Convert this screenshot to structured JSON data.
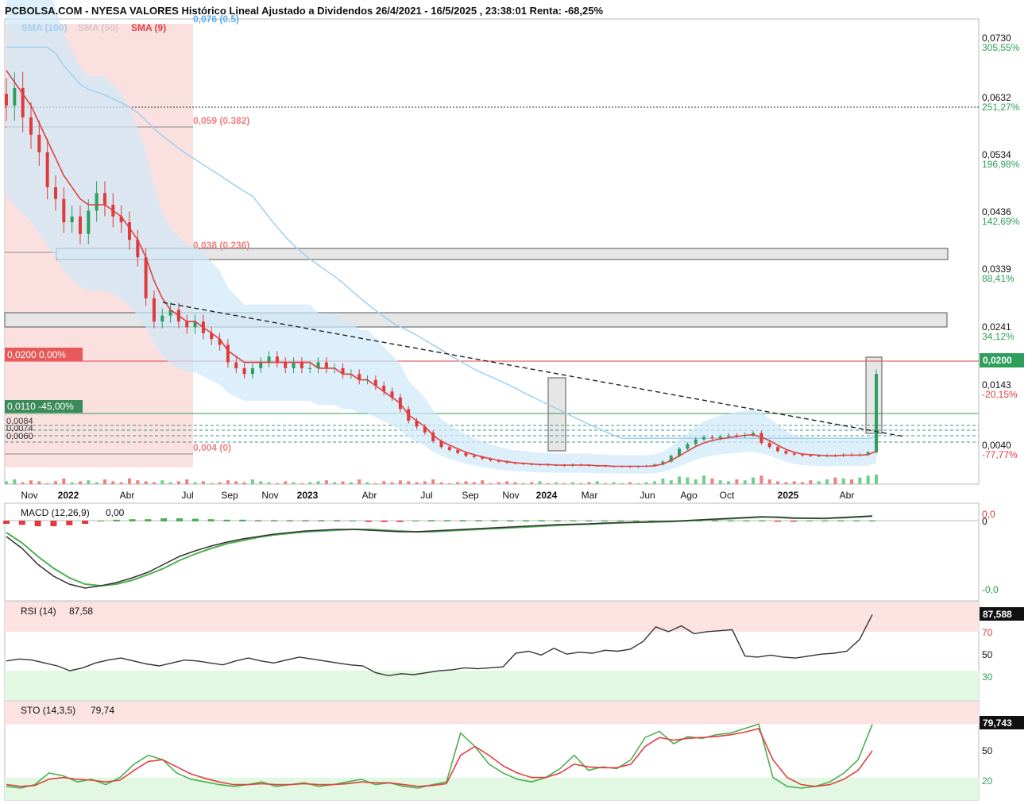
{
  "header": {
    "title": "PCBOLSA.COM - NYESA VALORES Histórico Lineal Ajustado a Dividendos 26/4/2021 - 16/5/2025 , 23:38:01 Renta: -68,25%"
  },
  "colors": {
    "up": "#2e9e5b",
    "down": "#e03a3a",
    "sma9": "#e04040",
    "sma100": "#9fd0f0",
    "bollinger": "#cfe8f8",
    "fib_zone": "#f9d5d5",
    "price_line": "#e04040",
    "macd_line": "#333333",
    "signal_line": "#4caf50",
    "rsi_line": "#333333",
    "sto_k": "#4caf50",
    "sto_d": "#e04040"
  },
  "chart_data": [
    {
      "type": "candlestick",
      "panel": "price",
      "indicators": {
        "legend_sma100": "SMA (100)",
        "legend_sma50": "SMA (50)",
        "legend_sma9": "SMA (9)"
      },
      "x_ticks": [
        "Nov",
        "2022",
        "Abr",
        "Jul",
        "Sep",
        "Nov",
        "2023",
        "Abr",
        "Jul",
        "Sep",
        "Nov",
        "2024",
        "Mar",
        "Jun",
        "Ago",
        "Oct",
        "2025",
        "Abr"
      ],
      "y_ticks": [
        {
          "value": "0,0730",
          "pct": "305,55%"
        },
        {
          "value": "0,0632",
          "pct": "251,27%"
        },
        {
          "value": "0,0534",
          "pct": "196,98%"
        },
        {
          "value": "0,0436",
          "pct": "142,69%"
        },
        {
          "value": "0,0339",
          "pct": "88,41%"
        },
        {
          "value": "0,0241",
          "pct": "34,12%"
        },
        {
          "value": "0,0143",
          "pct": "-20,15%"
        },
        {
          "value": "0,0040",
          "pct": "-77,77%"
        }
      ],
      "last_price_label": "0,0200",
      "fibonacci": [
        {
          "label": "0,076 (0.5)"
        },
        {
          "label": "0,059 (0.382)"
        },
        {
          "label": "0,038 (0.236)"
        },
        {
          "label": "0,004 (0)"
        }
      ],
      "level_labels": [
        {
          "label": "0,0200  0,00%"
        },
        {
          "label": "0,0110  -45,00%"
        },
        {
          "label": "0,0084"
        },
        {
          "label": "0,0074"
        },
        {
          "label": "0,0060"
        }
      ],
      "close_series": [
        0.066,
        0.069,
        0.064,
        0.061,
        0.058,
        0.052,
        0.05,
        0.046,
        0.047,
        0.044,
        0.048,
        0.051,
        0.049,
        0.047,
        0.046,
        0.043,
        0.04,
        0.033,
        0.029,
        0.03,
        0.031,
        0.029,
        0.028,
        0.029,
        0.027,
        0.026,
        0.025,
        0.022,
        0.021,
        0.02,
        0.021,
        0.022,
        0.023,
        0.022,
        0.021,
        0.022,
        0.021,
        0.021,
        0.022,
        0.021,
        0.021,
        0.02,
        0.02,
        0.019,
        0.019,
        0.018,
        0.017,
        0.016,
        0.014,
        0.012,
        0.011,
        0.01,
        0.0085,
        0.0075,
        0.007,
        0.0065,
        0.006,
        0.0058,
        0.0055,
        0.0052,
        0.005,
        0.0048,
        0.0047,
        0.0046,
        0.0045,
        0.0045,
        0.0044,
        0.0044,
        0.0043,
        0.0045,
        0.0044,
        0.0043,
        0.0043,
        0.0042,
        0.0042,
        0.0042,
        0.0041,
        0.0042,
        0.0043,
        0.0045,
        0.005,
        0.006,
        0.0072,
        0.008,
        0.0088,
        0.0092,
        0.009,
        0.0093,
        0.0095,
        0.0094,
        0.0096,
        0.0099,
        0.0082,
        0.0075,
        0.0068,
        0.0064,
        0.0062,
        0.0061,
        0.006,
        0.006,
        0.0061,
        0.006,
        0.0062,
        0.0061,
        0.0062,
        0.0066,
        0.02
      ],
      "volume": [
        0.3,
        0.5,
        0.2,
        0.4,
        0.3,
        0.1,
        0.3,
        0.6,
        0.2,
        0.3,
        0.4,
        0.2,
        0.5,
        0.3,
        0.2,
        0.6,
        0.4,
        0.3,
        0.2,
        0.4,
        0.2,
        0.3,
        0.5,
        0.2,
        0.3,
        0.1,
        0.2,
        0.4,
        0.3,
        0.2,
        0.5,
        0.3,
        0.2,
        0.1,
        0.3,
        0.2,
        0.1,
        0.2,
        0.3,
        0.4,
        0.2,
        0.3,
        0.2,
        0.5,
        0.2,
        0.1,
        0.3,
        0.2,
        0.4,
        0.3,
        0.2,
        0.3,
        0.5,
        0.2,
        0.1,
        0.2,
        0.3,
        0.2,
        0.4,
        0.1,
        0.2,
        0.3,
        0.2,
        0.1,
        0.2,
        0.3,
        0.1,
        0.2,
        0.1,
        0.2,
        0.1,
        0.2,
        0.3,
        0.1,
        0.2,
        0.1,
        0.2,
        0.1,
        0.2,
        0.3,
        0.6,
        0.4,
        0.8,
        0.7,
        0.5,
        0.9,
        0.6,
        0.4,
        0.3,
        0.5,
        0.4,
        0.7,
        0.9,
        0.5,
        0.3,
        0.2,
        0.3,
        0.2,
        0.4,
        0.3,
        0.5,
        0.7,
        0.6,
        0.5,
        0.7,
        0.9,
        1.0
      ],
      "sma9_series": [
        0.072,
        0.07,
        0.068,
        0.066,
        0.063,
        0.06,
        0.057,
        0.054,
        0.052,
        0.05,
        0.049,
        0.049,
        0.049,
        0.048,
        0.047,
        0.045,
        0.043,
        0.04,
        0.036,
        0.033,
        0.031,
        0.03,
        0.029,
        0.029,
        0.028,
        0.027,
        0.026,
        0.024,
        0.023,
        0.022,
        0.022,
        0.022,
        0.022,
        0.022,
        0.022,
        0.022,
        0.022,
        0.022,
        0.021,
        0.021,
        0.021,
        0.02,
        0.02,
        0.019,
        0.019,
        0.018,
        0.017,
        0.016,
        0.015,
        0.013,
        0.012,
        0.011,
        0.0095,
        0.0085,
        0.0078,
        0.0072,
        0.0066,
        0.0062,
        0.0058,
        0.0055,
        0.0052,
        0.005,
        0.0048,
        0.0047,
        0.0046,
        0.0045,
        0.0045,
        0.0044,
        0.0044,
        0.0044,
        0.0044,
        0.0044,
        0.0043,
        0.0043,
        0.0042,
        0.0042,
        0.0042,
        0.0042,
        0.0042,
        0.0043,
        0.0046,
        0.0052,
        0.006,
        0.0068,
        0.0076,
        0.0082,
        0.0086,
        0.0089,
        0.0091,
        0.0093,
        0.0095,
        0.0096,
        0.0092,
        0.0086,
        0.0078,
        0.0071,
        0.0066,
        0.0063,
        0.0062,
        0.0061,
        0.006,
        0.006,
        0.0061,
        0.0061,
        0.0061,
        0.0062,
        0.0068
      ]
    },
    {
      "type": "line",
      "panel": "macd",
      "label": "MACD (12,26,9)",
      "value_text": "0,00",
      "y_ticks": [
        "0,0",
        "0",
        "-0,0"
      ],
      "macd": [
        -0.2,
        -0.35,
        -0.55,
        -0.7,
        -0.8,
        -0.85,
        -0.82,
        -0.78,
        -0.72,
        -0.65,
        -0.55,
        -0.45,
        -0.38,
        -0.32,
        -0.27,
        -0.23,
        -0.2,
        -0.17,
        -0.15,
        -0.13,
        -0.12,
        -0.11,
        -0.11,
        -0.12,
        -0.13,
        -0.14,
        -0.14,
        -0.13,
        -0.12,
        -0.11,
        -0.1,
        -0.09,
        -0.08,
        -0.07,
        -0.06,
        -0.05,
        -0.045,
        -0.04,
        -0.03,
        -0.025,
        -0.02,
        -0.015,
        -0.01,
        0.0,
        0.01,
        0.02,
        0.03,
        0.04,
        0.05,
        0.04,
        0.03,
        0.03,
        0.03,
        0.04,
        0.05,
        0.06
      ],
      "signal": [
        -0.15,
        -0.28,
        -0.45,
        -0.6,
        -0.72,
        -0.8,
        -0.82,
        -0.8,
        -0.75,
        -0.68,
        -0.6,
        -0.5,
        -0.42,
        -0.35,
        -0.29,
        -0.25,
        -0.21,
        -0.18,
        -0.16,
        -0.14,
        -0.13,
        -0.12,
        -0.11,
        -0.11,
        -0.12,
        -0.13,
        -0.14,
        -0.14,
        -0.13,
        -0.12,
        -0.11,
        -0.1,
        -0.09,
        -0.08,
        -0.07,
        -0.06,
        -0.05,
        -0.045,
        -0.035,
        -0.028,
        -0.022,
        -0.017,
        -0.012,
        -0.005,
        0.005,
        0.015,
        0.025,
        0.035,
        0.045,
        0.045,
        0.035,
        0.03,
        0.028,
        0.035,
        0.045,
        0.055
      ]
    },
    {
      "type": "line",
      "panel": "rsi",
      "label": "RSI (14)",
      "value_text": "87,58",
      "last_value_label": "87,588",
      "y_ticks": [
        "70",
        "50",
        "30"
      ],
      "ylim": [
        0,
        100
      ],
      "values": [
        40,
        42,
        41,
        38,
        35,
        30,
        33,
        38,
        41,
        43,
        40,
        37,
        35,
        38,
        41,
        40,
        38,
        36,
        40,
        43,
        40,
        38,
        41,
        44,
        42,
        40,
        38,
        36,
        35,
        28,
        25,
        27,
        26,
        28,
        30,
        31,
        33,
        32,
        33,
        34,
        48,
        50,
        46,
        53,
        47,
        49,
        48,
        51,
        50,
        52,
        60,
        75,
        70,
        76,
        68,
        70,
        71,
        72,
        45,
        44,
        46,
        44,
        43,
        45,
        47,
        48,
        50,
        62,
        87.6
      ]
    },
    {
      "type": "line",
      "panel": "sto",
      "label": "STO (14,3,5)",
      "value_text": "79,74",
      "last_value_label": "79,743",
      "y_ticks": [
        "50",
        "20"
      ],
      "ylim": [
        0,
        100
      ],
      "k": [
        10,
        8,
        12,
        25,
        22,
        15,
        18,
        12,
        20,
        35,
        45,
        40,
        25,
        18,
        15,
        12,
        10,
        12,
        15,
        10,
        12,
        14,
        10,
        12,
        15,
        18,
        12,
        14,
        10,
        8,
        12,
        15,
        70,
        55,
        35,
        25,
        18,
        15,
        20,
        30,
        45,
        28,
        32,
        30,
        40,
        65,
        72,
        58,
        66,
        64,
        68,
        70,
        75,
        80,
        20,
        10,
        8,
        10,
        15,
        25,
        40,
        79.7
      ],
      "d": [
        12,
        10,
        11,
        18,
        20,
        18,
        17,
        15,
        17,
        28,
        38,
        40,
        32,
        24,
        19,
        15,
        12,
        12,
        13,
        12,
        12,
        13,
        12,
        12,
        13,
        15,
        14,
        14,
        12,
        10,
        11,
        13,
        45,
        55,
        45,
        33,
        25,
        20,
        20,
        25,
        35,
        32,
        31,
        31,
        35,
        55,
        65,
        62,
        64,
        65,
        66,
        68,
        71,
        75,
        40,
        20,
        12,
        10,
        12,
        18,
        28,
        50
      ]
    }
  ]
}
